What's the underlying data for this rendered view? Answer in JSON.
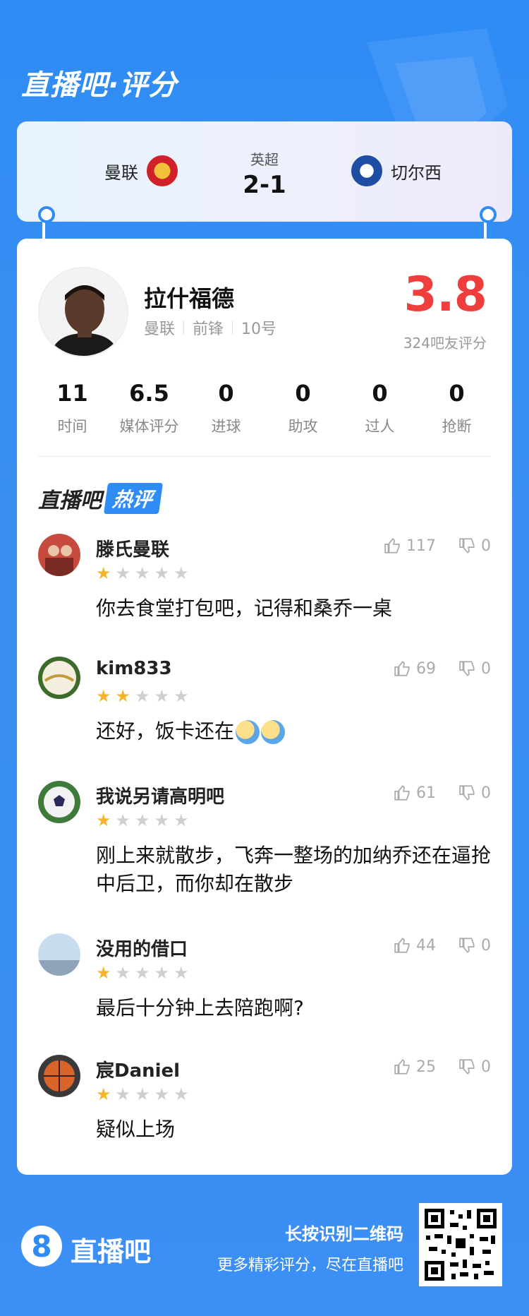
{
  "header": {
    "title": "直播吧·评分"
  },
  "match": {
    "home_team": "曼联",
    "away_team": "切尔西",
    "league": "英超",
    "score": "2-1"
  },
  "player": {
    "name": "拉什福德",
    "team": "曼联",
    "position": "前锋",
    "number": "10号",
    "rating": "3.8",
    "rating_count": "324吧友评分"
  },
  "stats": [
    {
      "value": "11",
      "label": "时间"
    },
    {
      "value": "6.5",
      "label": "媒体评分"
    },
    {
      "value": "0",
      "label": "进球"
    },
    {
      "value": "0",
      "label": "助攻"
    },
    {
      "value": "0",
      "label": "过人"
    },
    {
      "value": "0",
      "label": "抢断"
    }
  ],
  "hot_comments": {
    "title_part1": "直播吧",
    "title_part2": "热评",
    "items": [
      {
        "user": "滕氏曼联",
        "stars": 1,
        "text": "你去食堂打包吧，记得和桑乔一桌",
        "likes": "117",
        "dislikes": "0"
      },
      {
        "user": "kim833",
        "stars": 2,
        "text": "还好，饭卡还在",
        "likes": "69",
        "dislikes": "0"
      },
      {
        "user": "我说另请高明吧",
        "stars": 1,
        "text": "刚上来就散步，飞奔一整场的加纳乔还在逼抢中后卫，而你却在散步",
        "likes": "61",
        "dislikes": "0"
      },
      {
        "user": "没用的借口",
        "stars": 1,
        "text": "最后十分钟上去陪跑啊?",
        "likes": "44",
        "dislikes": "0"
      },
      {
        "user": "宸Daniel",
        "stars": 1,
        "text": "疑似上场",
        "likes": "25",
        "dislikes": "0"
      }
    ]
  },
  "footer": {
    "logo_glyph": "8",
    "brand": "直播吧",
    "line1": "长按识别二维码",
    "line2": "更多精彩评分，尽在直播吧"
  },
  "colors": {
    "brand_blue": "#2f8cf5",
    "rating_red": "#ef3e3e",
    "star_gold": "#f5b52b"
  }
}
